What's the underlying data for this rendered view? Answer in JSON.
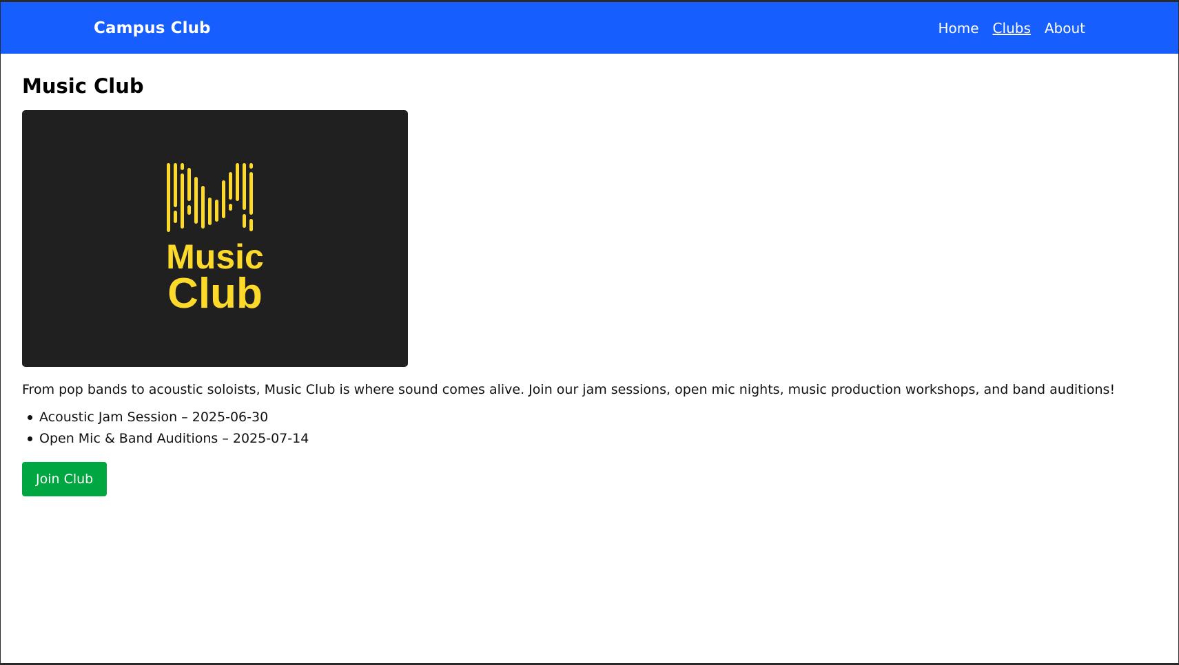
{
  "navbar": {
    "brand": "Campus Club",
    "links": [
      {
        "label": "Home",
        "active": false
      },
      {
        "label": "Clubs",
        "active": true
      },
      {
        "label": "About",
        "active": false
      }
    ]
  },
  "club": {
    "title": "Music Club",
    "logo": {
      "line1": "Music",
      "line2": "Club",
      "background_color": "#202020",
      "accent_color": "#fdd92a"
    },
    "description": "From pop bands to acoustic soloists, Music Club is where sound comes alive. Join our jam sessions, open mic nights, music production workshops, and band auditions!",
    "events": [
      "Acoustic Jam Session – 2025-06-30",
      "Open Mic & Band Auditions – 2025-07-14"
    ],
    "join_label": "Join Club"
  },
  "colors": {
    "navbar": "#175efe",
    "join_button": "#00a63f"
  }
}
